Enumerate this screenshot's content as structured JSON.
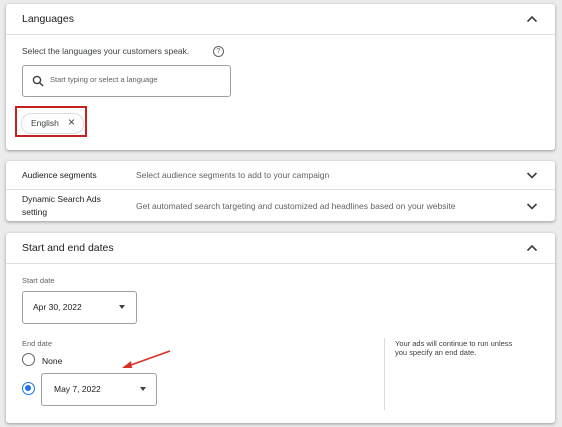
{
  "languages": {
    "title": "Languages",
    "prompt": "Select the languages your customers speak.",
    "search_placeholder": "Start typing or select a language",
    "selected_chip": "English",
    "chip_remove": "×"
  },
  "audience": {
    "label": "Audience segments",
    "description": "Select audience segments to add to your campaign"
  },
  "dsa": {
    "label_line1": "Dynamic Search Ads",
    "label_line2": "setting",
    "description": "Get automated search targeting and customized ad headlines based on your website"
  },
  "dates": {
    "title": "Start and end dates",
    "start_label": "Start date",
    "start_value": "Apr 30, 2022",
    "end_label": "End date",
    "none_option": "None",
    "end_value": "May 7, 2022",
    "end_selected": "date",
    "note_line1": "Your ads will continue to run unless",
    "note_line2": "you specify an end date."
  },
  "colors": {
    "accent": "#1a73e8",
    "highlight_box": "#c5221f",
    "annotation_arrow": "#d93025"
  }
}
